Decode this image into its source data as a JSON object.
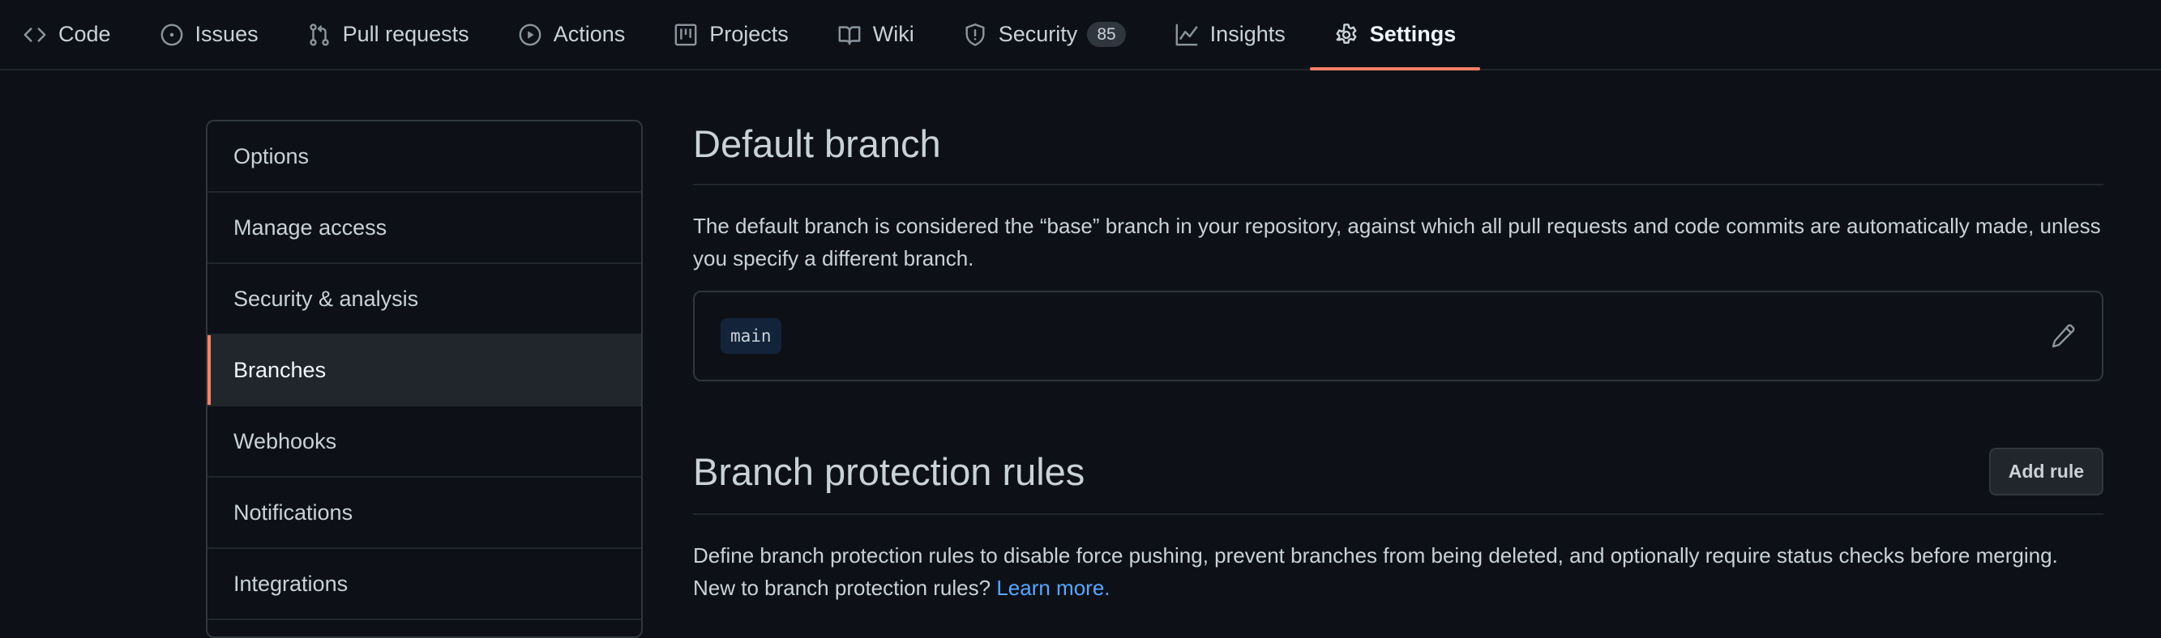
{
  "nav": {
    "items": [
      {
        "label": "Code",
        "icon": "code-icon"
      },
      {
        "label": "Issues",
        "icon": "issue-opened-icon"
      },
      {
        "label": "Pull requests",
        "icon": "git-pull-request-icon"
      },
      {
        "label": "Actions",
        "icon": "play-icon"
      },
      {
        "label": "Projects",
        "icon": "project-icon"
      },
      {
        "label": "Wiki",
        "icon": "book-icon"
      },
      {
        "label": "Security",
        "icon": "shield-icon",
        "counter": "85"
      },
      {
        "label": "Insights",
        "icon": "graph-icon"
      },
      {
        "label": "Settings",
        "icon": "gear-icon",
        "selected": true
      }
    ]
  },
  "menu": {
    "items": [
      {
        "label": "Options"
      },
      {
        "label": "Manage access"
      },
      {
        "label": "Security & analysis"
      },
      {
        "label": "Branches",
        "selected": true
      },
      {
        "label": "Webhooks"
      },
      {
        "label": "Notifications"
      },
      {
        "label": "Integrations"
      }
    ]
  },
  "default_branch": {
    "title": "Default branch",
    "description": "The default branch is considered the “base” branch in your repository, against which all pull requests and code commits are automatically made, unless you specify a different branch.",
    "branch": "main",
    "edit_icon": "pencil-icon"
  },
  "protection": {
    "title": "Branch protection rules",
    "add_button": "Add rule",
    "description": "Define branch protection rules to disable force pushing, prevent branches from being deleted, and optionally require status checks before merging. New to branch protection rules?",
    "learn_more": "Learn more."
  },
  "colors": {
    "background": "#0d1117",
    "accent": "#f78166",
    "link": "#58a6ff",
    "border": "#30363d"
  }
}
